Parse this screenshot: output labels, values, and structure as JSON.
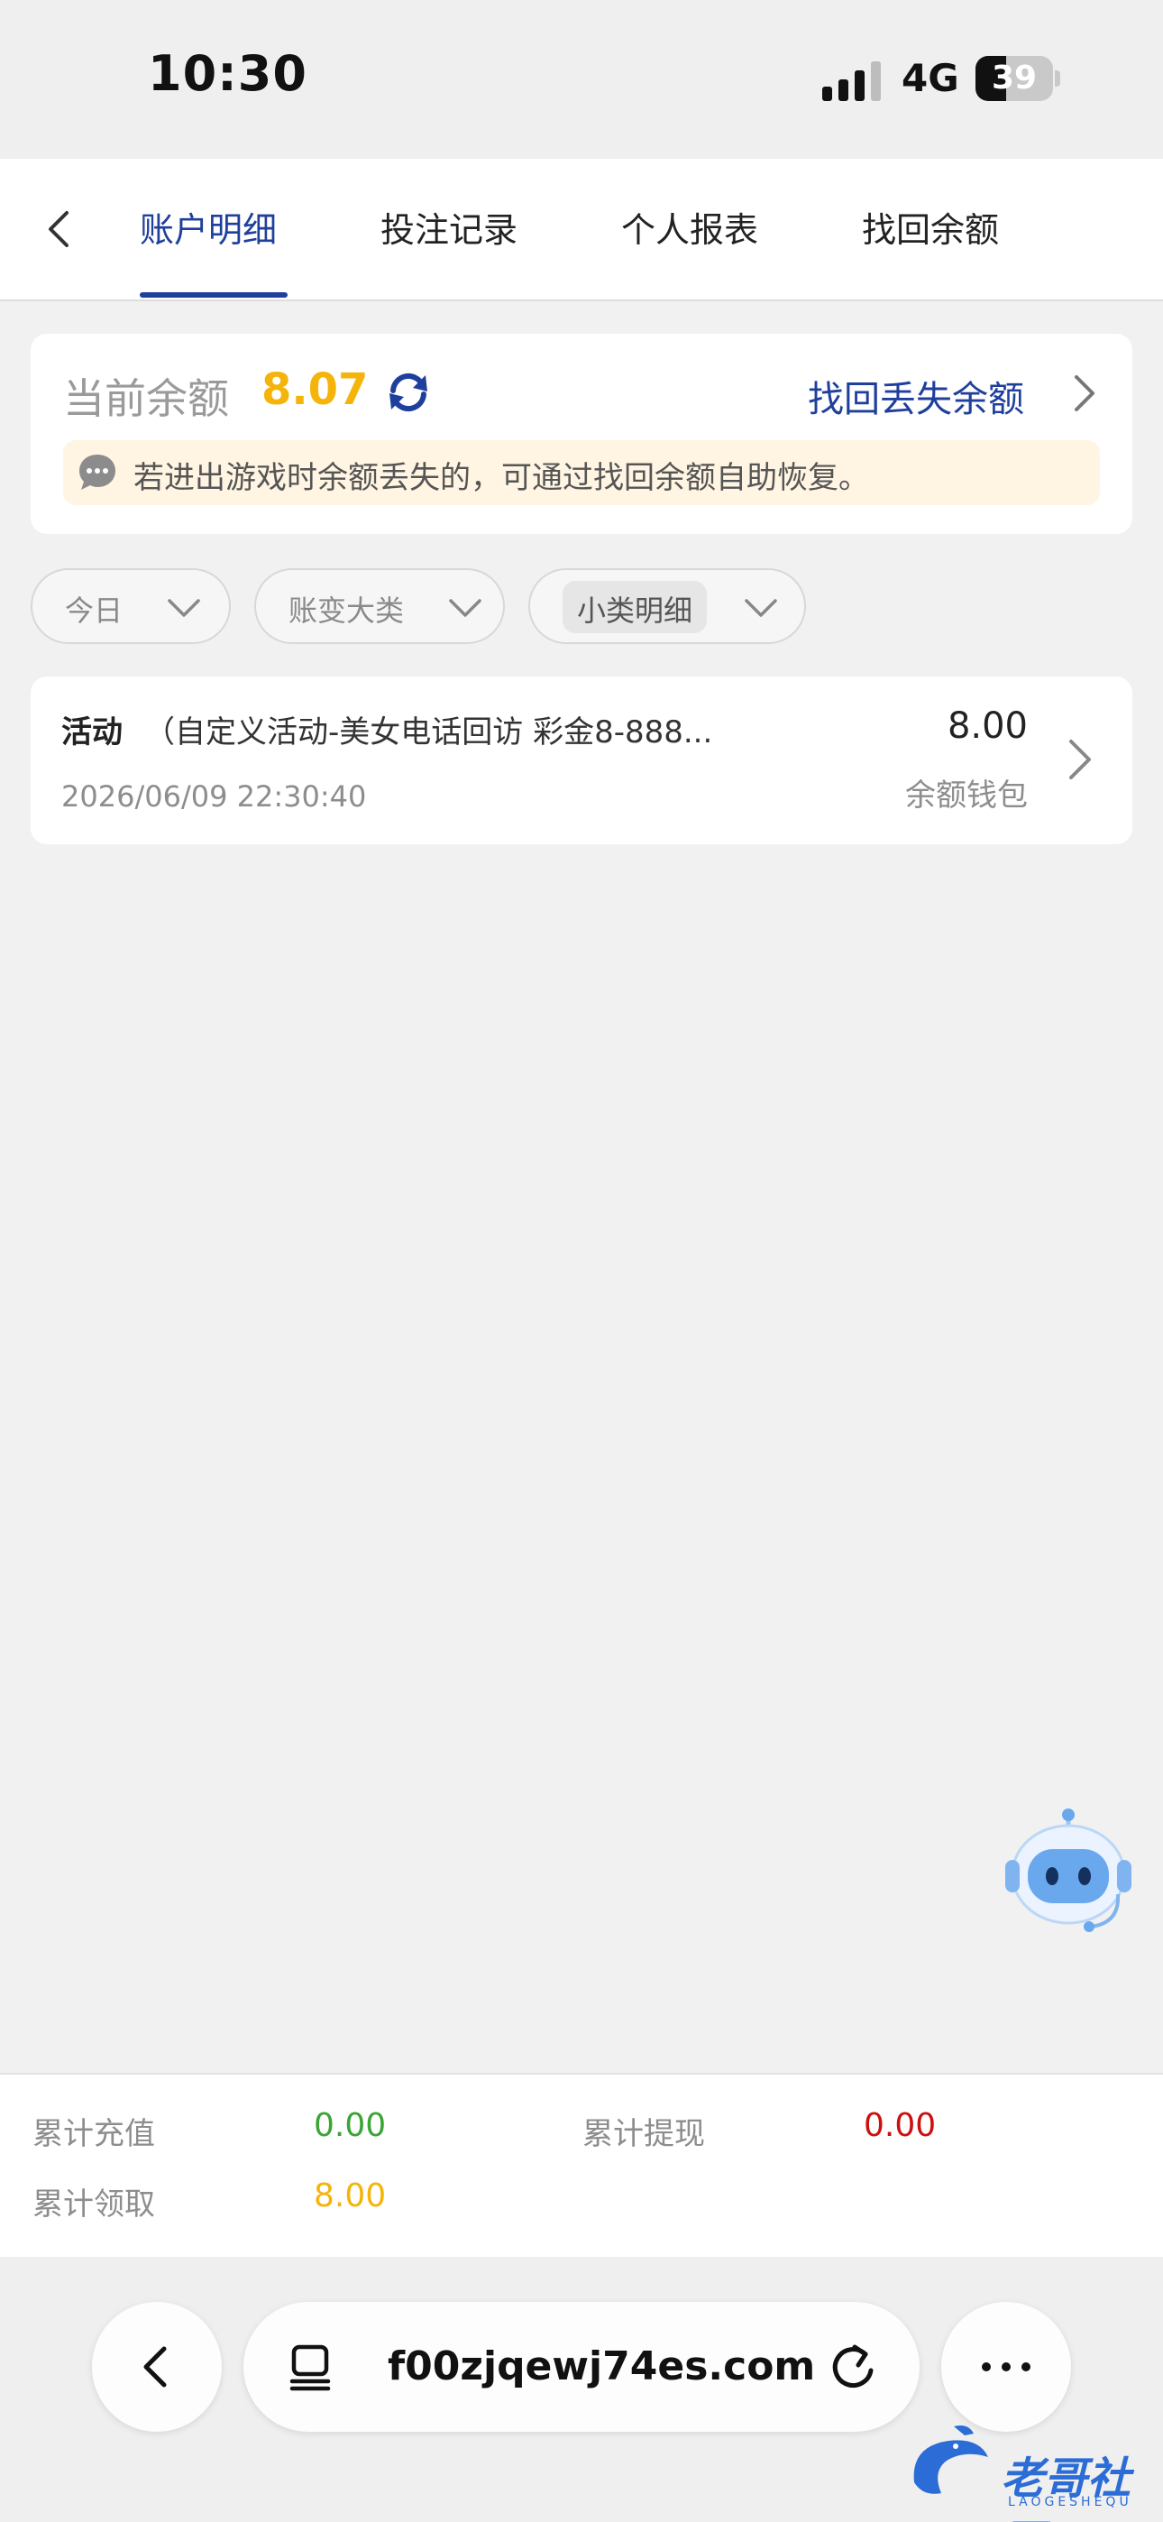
{
  "status_bar": {
    "time": "10:30",
    "network": "4G",
    "battery": "39"
  },
  "tabs": [
    {
      "label": "账户明细"
    },
    {
      "label": "投注记录"
    },
    {
      "label": "个人报表"
    },
    {
      "label": "找回余额"
    }
  ],
  "balance": {
    "label": "当前余额",
    "value": "8.07",
    "recover_link": "找回丢失余额",
    "notice": "若进出游戏时余额丢失的，可通过找回余额自助恢复。"
  },
  "filters": [
    {
      "label": "今日"
    },
    {
      "label": "账变大类"
    },
    {
      "label": "小类明细"
    }
  ],
  "records": [
    {
      "title": "活动",
      "description": "（自定义活动-美女电话回访 彩金8-888...",
      "datetime": "2026/06/09 22:30:40",
      "amount": "8.00",
      "wallet": "余额钱包"
    }
  ],
  "summary": {
    "recharge_label": "累计充值",
    "recharge_value": "0.00",
    "withdraw_label": "累计提现",
    "withdraw_value": "0.00",
    "claim_label": "累计领取",
    "claim_value": "8.00"
  },
  "browser": {
    "url": "f00zjqewj74es.com"
  },
  "watermark": {
    "text": "老哥社区",
    "sub": "LAOGESHEQU"
  },
  "colors": {
    "accent": "#1f3f9d",
    "balance": "#f4b40a",
    "recharge": "#3aa535",
    "withdraw": "#cc1010",
    "claim": "#f4b40a"
  }
}
